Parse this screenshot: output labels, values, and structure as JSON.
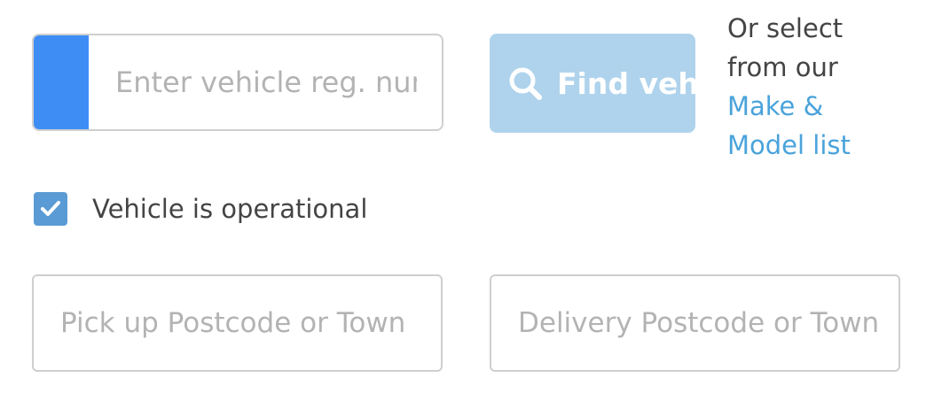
{
  "registration": {
    "placeholder": "Enter vehicle reg. number",
    "value": ""
  },
  "find_button": {
    "label": "Find vehicle",
    "icon": "search-icon"
  },
  "alt_selection": {
    "prefix": "Or select from our",
    "link_label": "Make & Model list"
  },
  "operational": {
    "label": "Vehicle is operational",
    "checked": true
  },
  "pickup": {
    "placeholder": "Pick up Postcode or Town",
    "value": ""
  },
  "delivery": {
    "placeholder": "Delivery Postcode or Town",
    "value": ""
  },
  "colors": {
    "accent_blue": "#3e8df5",
    "button_bg": "#afd3ec",
    "link": "#4aa3db",
    "checkbox": "#5b9bd5",
    "border": "#cfcfcf",
    "placeholder": "#b3b3b3",
    "text": "#444444"
  }
}
